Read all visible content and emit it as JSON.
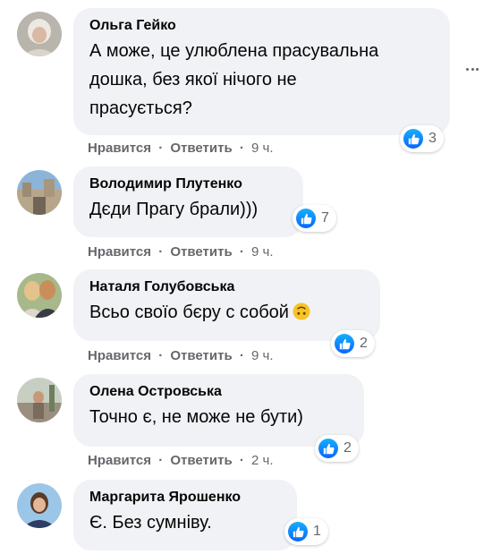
{
  "colors": {
    "bubble": "#f0f2f5",
    "meta": "#65676b",
    "like_blue": "#0866ff"
  },
  "icons": {
    "like": "like-icon",
    "more": "more-options-icon",
    "emoji": "upside-down-face-emoji"
  },
  "comments": [
    {
      "author": "Ольга Гейко",
      "lines": [
        "А може, це улюблена прасувальна",
        "дошка, без якої нічого не",
        "прасується?"
      ],
      "reaction_count": "3",
      "like": "Нравится",
      "sep": "·",
      "reply": "Ответить",
      "time": "9 ч."
    },
    {
      "author": "Володимир Плутенко",
      "lines": [
        "Дєди Прагу брали)))"
      ],
      "reaction_count": "7",
      "like": "Нравится",
      "sep": "·",
      "reply": "Ответить",
      "time": "9 ч."
    },
    {
      "author": "Наталя Голубовська",
      "lines": [
        "Всьо своїо бєру с собой"
      ],
      "reaction_count": "2",
      "like": "Нравится",
      "sep": "·",
      "reply": "Ответить",
      "time": "9 ч."
    },
    {
      "author": "Олена Островська",
      "lines": [
        "Точно є, не може не бути)"
      ],
      "reaction_count": "2",
      "like": "Нравится",
      "sep": "·",
      "reply": "Ответить",
      "time": "2 ч."
    },
    {
      "author": "Маргарита Ярошенко",
      "lines": [
        "Є. Без сумніву."
      ],
      "reaction_count": "1"
    }
  ]
}
